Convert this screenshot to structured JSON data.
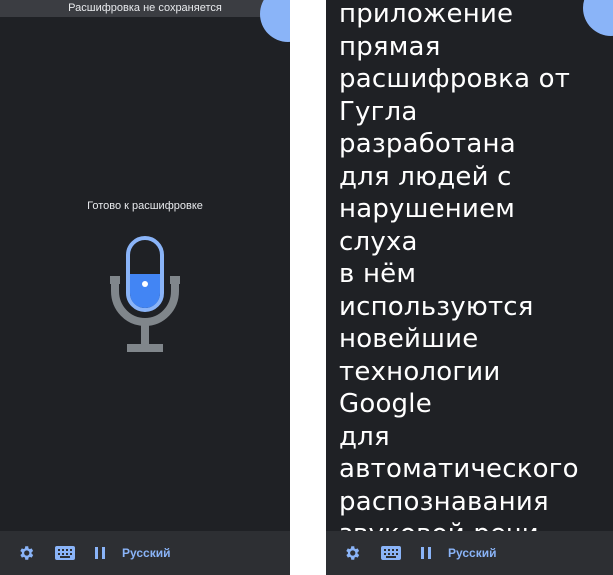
{
  "left_screen": {
    "banner": "Расшифровка не сохраняется",
    "status": "Готово к расшифровке",
    "mic_icon": "microphone-icon",
    "bottom_bar": {
      "settings_icon": "gear-icon",
      "keyboard_icon": "keyboard-icon",
      "pause_icon": "pause-icon",
      "language": "Русский"
    }
  },
  "right_screen": {
    "transcript_lines": [
      "приложение",
      "прямая",
      "расшифровка от",
      "Гугла разработана",
      "для людей с",
      "нарушением слуха",
      "в нём",
      "используются",
      "новейшие",
      "технологии Google",
      "для",
      "автоматического",
      "распознавания",
      "звуковой речи"
    ],
    "bottom_bar": {
      "settings_icon": "gear-icon",
      "keyboard_icon": "keyboard-icon",
      "pause_icon": "pause-icon",
      "language": "Русский"
    }
  },
  "colors": {
    "background": "#1f2125",
    "accent": "#8ab4f8",
    "mic_fill": "#4285f4",
    "mic_stand": "#80868b"
  }
}
